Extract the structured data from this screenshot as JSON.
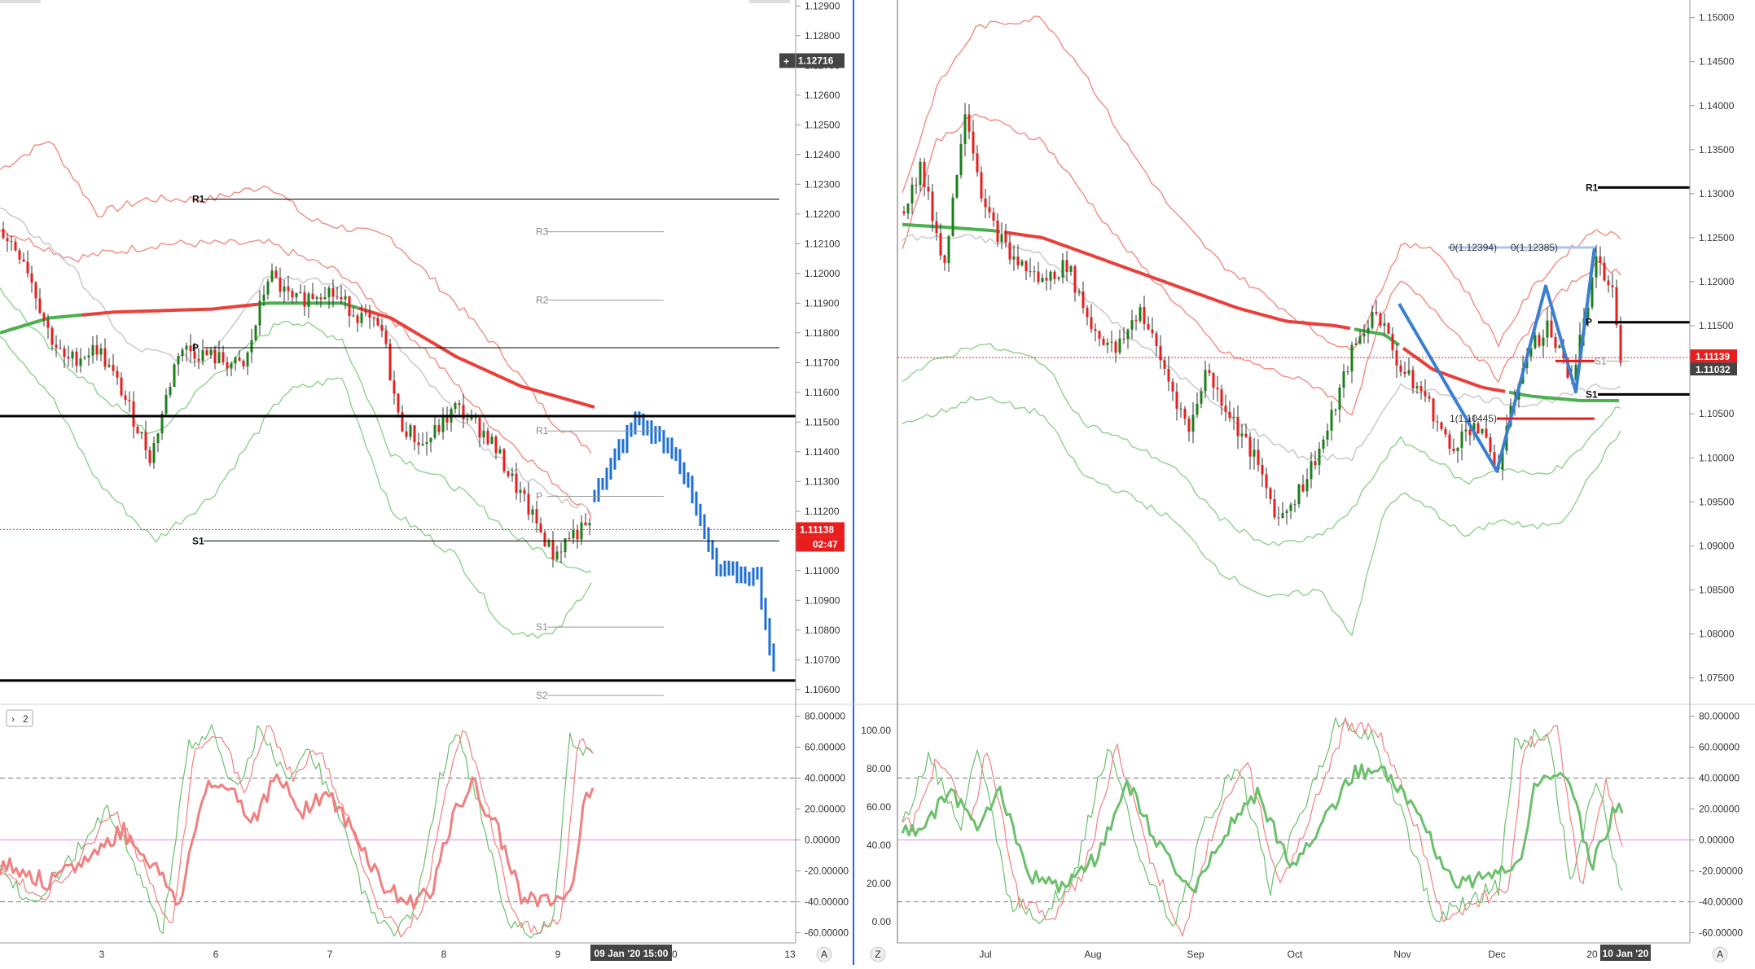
{
  "colors": {
    "background": "#ffffff",
    "separator": "#2962ff",
    "bull": "#1b7f1b",
    "bear": "#e81e1e",
    "ma_red": "#e8403a",
    "ma_green": "#4caf50",
    "band_red": "#f28b82",
    "band_green": "#8fd18f",
    "band_gray": "#cccccc",
    "heikin": "#1e6fd6",
    "pattern": "#3a7fd0",
    "osc_green": "#6cbf6c",
    "osc_red": "#f08080",
    "zero_line": "#ee82ee",
    "price_badge": "#e81e1e",
    "cursor_badge": "#444444"
  },
  "left_chart": {
    "y_ticks": [
      "1.12900",
      "1.12800",
      "1.12700",
      "1.12600",
      "1.12500",
      "1.12400",
      "1.12300",
      "1.12200",
      "1.12100",
      "1.12000",
      "1.11900",
      "1.11800",
      "1.11700",
      "1.11600",
      "1.11500",
      "1.11400",
      "1.11300",
      "1.11200",
      "1.11100",
      "1.11000",
      "1.10900",
      "1.10800",
      "1.10700",
      "1.10600"
    ],
    "x_ticks": [
      "3",
      "6",
      "7",
      "8",
      "9",
      "10",
      "13"
    ],
    "last_price": "1.11138",
    "countdown": "02:47",
    "cursor_price": "1.12716",
    "cursor_time": "09 Jan '20  15:00",
    "pivots": [
      "R1",
      "P",
      "S1"
    ],
    "pivots_gray": [
      "R3",
      "R2",
      "R1",
      "P",
      "S1",
      "S2"
    ],
    "osc_ticks": [
      "80.00000",
      "60.00000",
      "40.00000",
      "20.00000",
      "0.00000",
      "-20.00000",
      "-40.00000",
      "-60.00000"
    ],
    "osc_collapse_label": "2",
    "collapse_icon": "chevron-right-icon",
    "axis_button": "A"
  },
  "right_chart": {
    "y_ticks": [
      "1.15000",
      "1.14500",
      "1.14000",
      "1.13500",
      "1.13000",
      "1.12500",
      "1.12000",
      "1.11500",
      "1.11000",
      "1.10500",
      "1.10000",
      "1.09500",
      "1.09000",
      "1.08500",
      "1.08000",
      "1.07500"
    ],
    "x_ticks": [
      "Jul",
      "Aug",
      "Sep",
      "Oct",
      "Nov",
      "Dec",
      "20"
    ],
    "last_price": "1.11139",
    "price_2": "1.11032",
    "cursor_time": "10 Jan '20",
    "pivots": [
      "R1",
      "P",
      "S1"
    ],
    "pivots_gray": [
      "S1"
    ],
    "fib_labels": [
      "0(1.12394)",
      "0(1.12385)",
      "1(1.10445)"
    ],
    "osc_ticks_right": [
      "80.00000",
      "60.00000",
      "40.00000",
      "20.00000",
      "0.00000",
      "-20.00000",
      "-40.00000",
      "-60.00000"
    ],
    "osc_ticks_left": [
      "100.00",
      "80.00",
      "60.00",
      "40.00",
      "20.00",
      "0.00"
    ],
    "axis_button_z": "Z",
    "axis_button": "A"
  },
  "chart_data": [
    {
      "type": "candlestick",
      "title": "",
      "timeframe": "hourly (approx.)",
      "x_categories": [
        "3",
        "6",
        "7",
        "8",
        "9",
        "10",
        "13"
      ],
      "ylim": [
        1.1055,
        1.1292
      ],
      "series": [
        {
          "name": "",
          "kind": "moving-average",
          "values": [
            1.1188,
            1.1191,
            1.1187,
            1.1189,
            1.1184,
            1.117,
            1.1158
          ]
        },
        {
          "name": "",
          "kind": "heikin-ashi-projection",
          "values": [
            1.1125,
            1.1151,
            1.114,
            1.11,
            1.1098,
            1.106
          ]
        }
      ],
      "pivot_levels": {
        "R1": 1.1225,
        "P": 1.1175,
        "S1": 1.111
      },
      "horizontal_levels": [
        1.1152,
        1.1063
      ],
      "grey_pivots": {
        "R3": 1.1214,
        "R2": 1.1191,
        "R1": 1.1147,
        "P": 1.1125,
        "S1": 1.1081,
        "S2": 1.1058
      },
      "last_price": 1.11138
    },
    {
      "type": "candlestick",
      "title": "",
      "timeframe": "daily (approx.)",
      "x_categories": [
        "Jul",
        "Aug",
        "Sep",
        "Oct",
        "Nov",
        "Dec",
        "20"
      ],
      "ylim": [
        1.072,
        1.152
      ],
      "series": [
        {
          "name": "",
          "kind": "moving-average",
          "values": [
            1.127,
            1.125,
            1.12,
            1.115,
            1.112,
            1.107,
            1.106
          ]
        }
      ],
      "pivot_levels": {
        "R1": 1.1307,
        "P": 1.1154,
        "S1": 1.1072
      },
      "fibonacci": [
        1.12394,
        1.12385,
        1.10445
      ],
      "last_price": 1.11139
    },
    {
      "type": "line",
      "title": "",
      "kind": "stochastic-oscillator",
      "ylim": [
        -65,
        85
      ],
      "levels": [
        40,
        0,
        -40
      ]
    }
  ]
}
